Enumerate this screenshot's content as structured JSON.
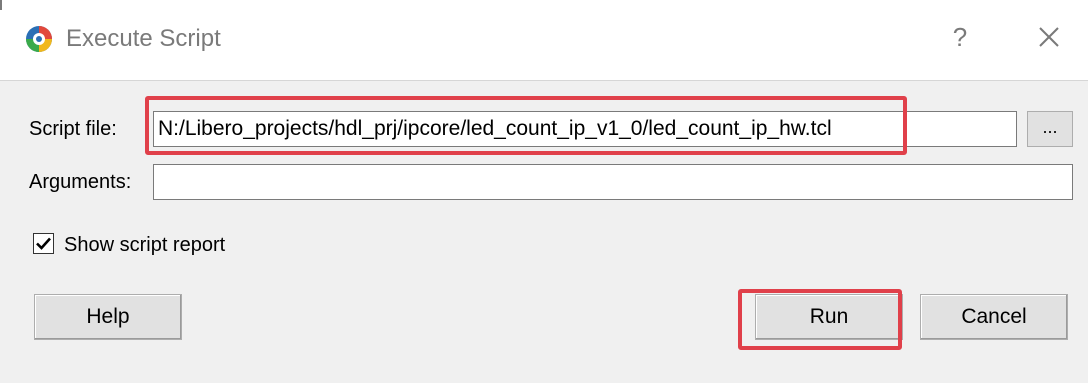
{
  "window": {
    "title": "Execute Script",
    "help_glyph": "?",
    "icon": "libero-app-icon",
    "close_icon": "close-icon"
  },
  "form": {
    "script_file_label": "Script file:",
    "script_file_value": "N:/Libero_projects/hdl_prj/ipcore/led_count_ip_v1_0/led_count_ip_hw.tcl",
    "browse_label": "...",
    "arguments_label": "Arguments:",
    "arguments_value": "",
    "show_report_label": "Show script report",
    "show_report_checked": true
  },
  "buttons": {
    "help": "Help",
    "run": "Run",
    "cancel": "Cancel"
  },
  "colors": {
    "highlight": "#e0404a",
    "dialog_bg": "#f0f0f0",
    "button_bg": "#e1e1e1"
  }
}
